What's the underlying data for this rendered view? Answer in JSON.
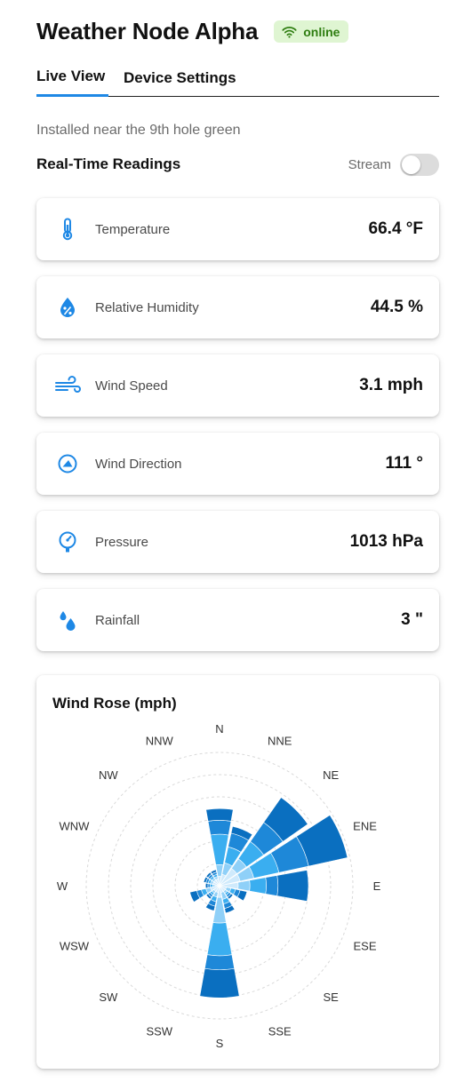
{
  "header": {
    "title": "Weather Node Alpha",
    "status_label": "online",
    "status_icon": "wifi-icon",
    "status_color": "#2e7d10",
    "status_bg": "#dff5d2"
  },
  "tabs": [
    {
      "label": "Live View",
      "active": true
    },
    {
      "label": "Device Settings",
      "active": false
    }
  ],
  "location_note": "Installed near the 9th hole green",
  "readings": {
    "title": "Real-Time Readings",
    "stream_label": "Stream",
    "stream_on": false,
    "items": [
      {
        "icon": "thermometer-icon",
        "label": "Temperature",
        "value": "66.4 °F"
      },
      {
        "icon": "humidity-drop-icon",
        "label": "Relative Humidity",
        "value": "44.5 %"
      },
      {
        "icon": "wind-icon",
        "label": "Wind Speed",
        "value": "3.1 mph"
      },
      {
        "icon": "compass-icon",
        "label": "Wind Direction",
        "value": "111 °"
      },
      {
        "icon": "gauge-icon",
        "label": "Pressure",
        "value": "1013 hPa"
      },
      {
        "icon": "raindrops-icon",
        "label": "Rainfall",
        "value": "3 \""
      }
    ]
  },
  "accent_color": "#1e88e5",
  "chart_data": {
    "type": "bar",
    "subtype": "polar-stacked",
    "title": "Wind Rose (mph)",
    "categories": [
      "N",
      "NNE",
      "NE",
      "ENE",
      "E",
      "ESE",
      "SE",
      "SSE",
      "S",
      "SSW",
      "SW",
      "WSW",
      "W",
      "WNW",
      "NW",
      "NNW"
    ],
    "series": [
      {
        "values": [
          0.4,
          0.5,
          0.9,
          0.9,
          0.8,
          0.3,
          0.3,
          0.3,
          0.5,
          0.3,
          0.3,
          0.4,
          0.2,
          0.3,
          0.3,
          0.3
        ],
        "color": "#cfeafc"
      },
      {
        "values": [
          0.5,
          0.5,
          0.5,
          0.6,
          0.5,
          0.2,
          0.1,
          0.3,
          1.1,
          0.2,
          0.1,
          0.2,
          0.1,
          0.1,
          0.1,
          0.1
        ],
        "color": "#8fd0f8"
      },
      {
        "values": [
          1.3,
          0.7,
          0.9,
          1.1,
          0.7,
          0.2,
          0.1,
          0.2,
          1.4,
          0.2,
          0.1,
          0.2,
          0.1,
          0.1,
          0.1,
          0.1
        ],
        "color": "#3aaef0"
      },
      {
        "values": [
          0.6,
          0.6,
          1.0,
          1.3,
          0.5,
          0.2,
          0.1,
          0.2,
          0.6,
          0.2,
          0.1,
          0.2,
          0.1,
          0.1,
          0.1,
          0.1
        ],
        "color": "#1e88d8"
      },
      {
        "values": [
          0.5,
          0.3,
          1.3,
          1.7,
          1.3,
          0.3,
          0.1,
          0.2,
          1.2,
          0.2,
          0.1,
          0.3,
          0.1,
          0.1,
          0.1,
          0.1
        ],
        "color": "#0a6fc0"
      }
    ],
    "radial_range": [
      0,
      5.7
    ],
    "grid_rings": 6,
    "grid": true
  }
}
